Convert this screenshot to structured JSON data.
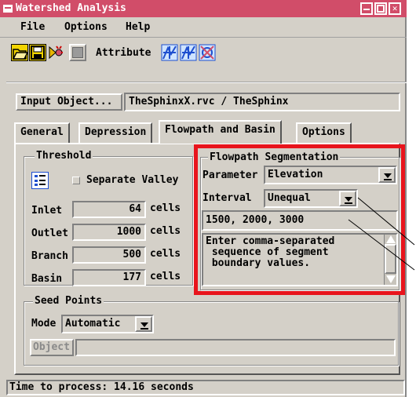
{
  "window": {
    "title": "Watershed Analysis"
  },
  "menubar": {
    "items": [
      "File",
      "Options",
      "Help"
    ]
  },
  "toolbar": {
    "attribute_label": "Attribute",
    "icons": [
      "open-folder-icon",
      "save-icon",
      "run-icon",
      "disabled-icon",
      "attribute-icon-1",
      "attribute-icon-2",
      "attribute-icon-3"
    ]
  },
  "input": {
    "button_label": "Input Object...",
    "value": "TheSphinxX.rvc / TheSphinx"
  },
  "tabs": [
    {
      "label": "General"
    },
    {
      "label": "Depression"
    },
    {
      "label": "Flowpath and Basin",
      "active": true
    },
    {
      "label": "Options"
    }
  ],
  "threshold": {
    "title": "Threshold",
    "separate_valley_label": "Separate Valley",
    "rows": [
      {
        "label": "Inlet",
        "value": "64",
        "unit": "cells"
      },
      {
        "label": "Outlet",
        "value": "1000",
        "unit": "cells"
      },
      {
        "label": "Branch",
        "value": "500",
        "unit": "cells"
      },
      {
        "label": "Basin",
        "value": "177",
        "unit": "cells"
      }
    ]
  },
  "flowpath": {
    "title": "Flowpath Segmentation",
    "parameter_label": "Parameter",
    "parameter_value": "Elevation",
    "interval_label": "Interval",
    "interval_value": "Unequal",
    "values_text": "1500, 2000, 3000",
    "help_lines": [
      "Enter comma-separated",
      " sequence of segment",
      " boundary values."
    ]
  },
  "seed": {
    "title": "Seed Points",
    "mode_label": "Mode",
    "mode_value": "Automatic",
    "object_button": "Object"
  },
  "status": {
    "text": "Time to process: 14.16 seconds"
  },
  "colors": {
    "titlebar": "#d14d69",
    "highlight_box": "#e8141c",
    "face": "#d4d0c8"
  }
}
